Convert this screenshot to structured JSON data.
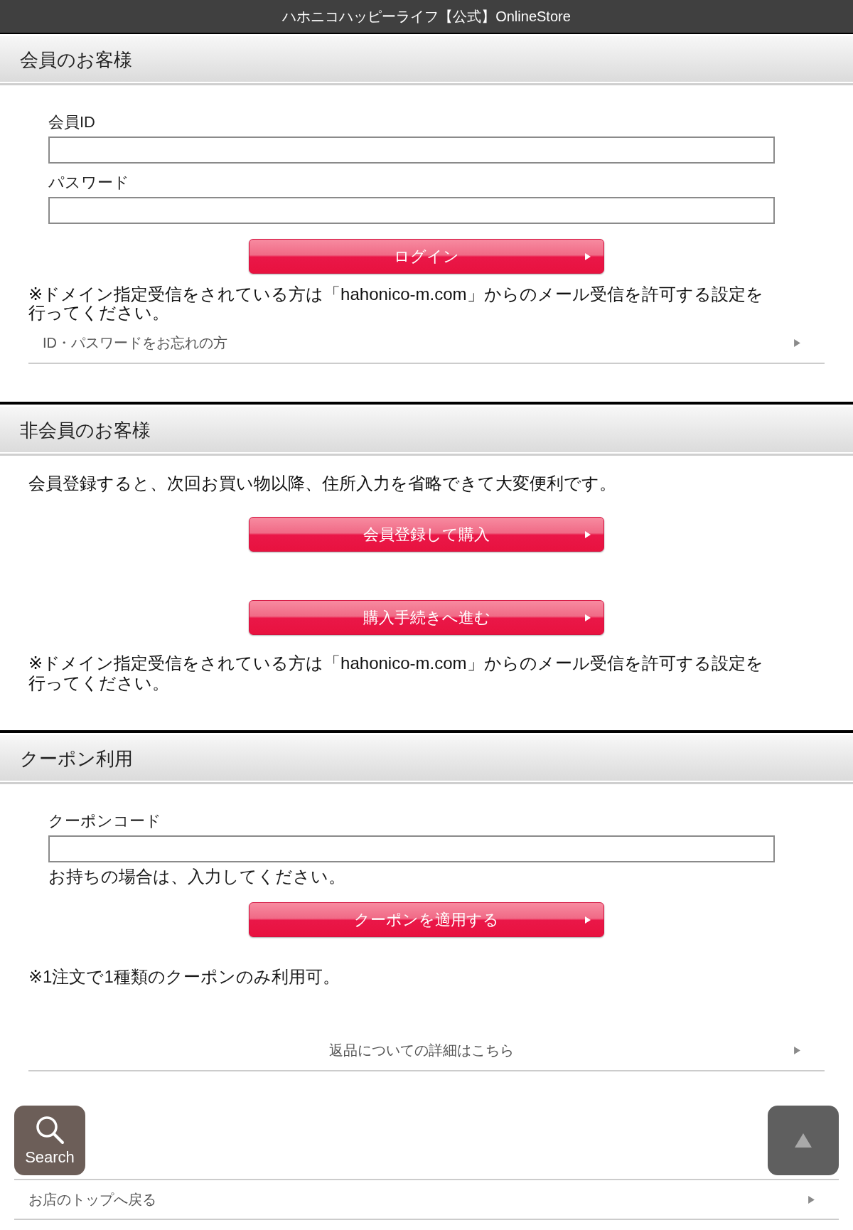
{
  "header": {
    "title": "ハホニコハッピーライフ【公式】OnlineStore"
  },
  "member_section": {
    "title": "会員のお客様",
    "fields": [
      {
        "label": "会員ID"
      },
      {
        "label": "パスワード"
      }
    ],
    "button": "ログイン",
    "note": "※ドメイン指定受信をされている方は「hahonico-m.com」からのメール受信を許可する設定を行ってください。",
    "link": "ID・パスワードをお忘れの方"
  },
  "guest_section": {
    "title": "非会員のお客様",
    "intro": "会員登録すると、次回お買い物以降、住所入力を省略できて大変便利です。",
    "buttons": [
      "会員登録して購入",
      "購入手続きへ進む"
    ],
    "note": "※ドメイン指定受信をされている方は「hahonico-m.com」からのメール受信を許可する設定を行ってください。"
  },
  "coupon_section": {
    "title": "クーポン利用",
    "field": {
      "label": "クーポンコード"
    },
    "hint": "お持ちの場合は、入力してください。",
    "button": "クーポンを適用する",
    "note": "※1注文で1種類のクーポンのみ利用可。",
    "link": "返品についての詳細はこちら"
  },
  "footer": {
    "search_label": "Search",
    "link": "お店のトップへ戻る"
  }
}
